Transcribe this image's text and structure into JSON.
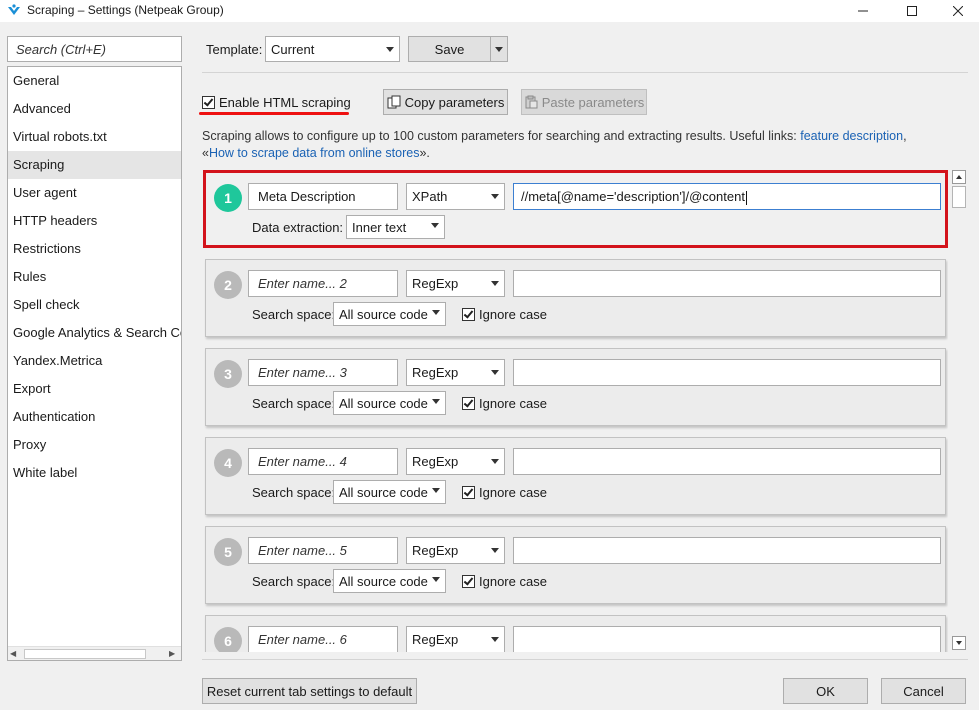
{
  "window": {
    "title": "Scraping – Settings (Netpeak Group)",
    "brand_color": "#1a8fd6"
  },
  "sidebar": {
    "search_placeholder": "Search (Ctrl+E)",
    "items": [
      {
        "label": "General"
      },
      {
        "label": "Advanced"
      },
      {
        "label": "Virtual robots.txt"
      },
      {
        "label": "Scraping",
        "selected": true
      },
      {
        "label": "User agent"
      },
      {
        "label": "HTTP headers"
      },
      {
        "label": "Restrictions"
      },
      {
        "label": "Rules"
      },
      {
        "label": "Spell check"
      },
      {
        "label": "Google Analytics & Search Co"
      },
      {
        "label": "Yandex.Metrica"
      },
      {
        "label": "Export"
      },
      {
        "label": "Authentication"
      },
      {
        "label": "Proxy"
      },
      {
        "label": "White label"
      }
    ]
  },
  "toolbar": {
    "template_label": "Template:",
    "template_value": "Current",
    "save_label": "Save"
  },
  "scraping": {
    "enable_label": "Enable HTML scraping",
    "enable_checked": true,
    "copy_label": "Copy parameters",
    "paste_label": "Paste parameters",
    "desc_text": "Scraping allows to configure up to 100 custom parameters for searching and extracting results. Useful links: ",
    "link_feature": "feature description",
    "desc_sep": ",",
    "desc_open_quote": "«",
    "link_stores": "How to scrape data from online stores",
    "desc_close_quote": "».",
    "highlight_color": "#d3131b",
    "active_color": "#1fc79b",
    "link_color": "#1a62b4"
  },
  "params": [
    {
      "num": "1",
      "name": "Meta Description",
      "placeholder": false,
      "type": "XPath",
      "expression": "//meta[@name='description']/@content",
      "row2_label": "Data extraction:",
      "row2_value": "Inner text",
      "show_ignore": false,
      "ignore_label": "",
      "active": true
    },
    {
      "num": "2",
      "name": "Enter name... 2",
      "placeholder": true,
      "type": "RegExp",
      "expression": "",
      "row2_label": "Search space:",
      "row2_value": "All source code",
      "show_ignore": true,
      "ignore_label": "Ignore case",
      "active": false
    },
    {
      "num": "3",
      "name": "Enter name... 3",
      "placeholder": true,
      "type": "RegExp",
      "expression": "",
      "row2_label": "Search space:",
      "row2_value": "All source code",
      "show_ignore": true,
      "ignore_label": "Ignore case",
      "active": false
    },
    {
      "num": "4",
      "name": "Enter name... 4",
      "placeholder": true,
      "type": "RegExp",
      "expression": "",
      "row2_label": "Search space:",
      "row2_value": "All source code",
      "show_ignore": true,
      "ignore_label": "Ignore case",
      "active": false
    },
    {
      "num": "5",
      "name": "Enter name... 5",
      "placeholder": true,
      "type": "RegExp",
      "expression": "",
      "row2_label": "Search space:",
      "row2_value": "All source code",
      "show_ignore": true,
      "ignore_label": "Ignore case",
      "active": false
    },
    {
      "num": "6",
      "name": "Enter name... 6",
      "placeholder": true,
      "type": "RegExp",
      "expression": "",
      "row2_label": "Search space:",
      "row2_value": "All source code",
      "show_ignore": true,
      "ignore_label": "Ignore case",
      "active": false
    }
  ],
  "footer": {
    "reset_label": "Reset current tab settings to default",
    "ok_label": "OK",
    "cancel_label": "Cancel"
  }
}
